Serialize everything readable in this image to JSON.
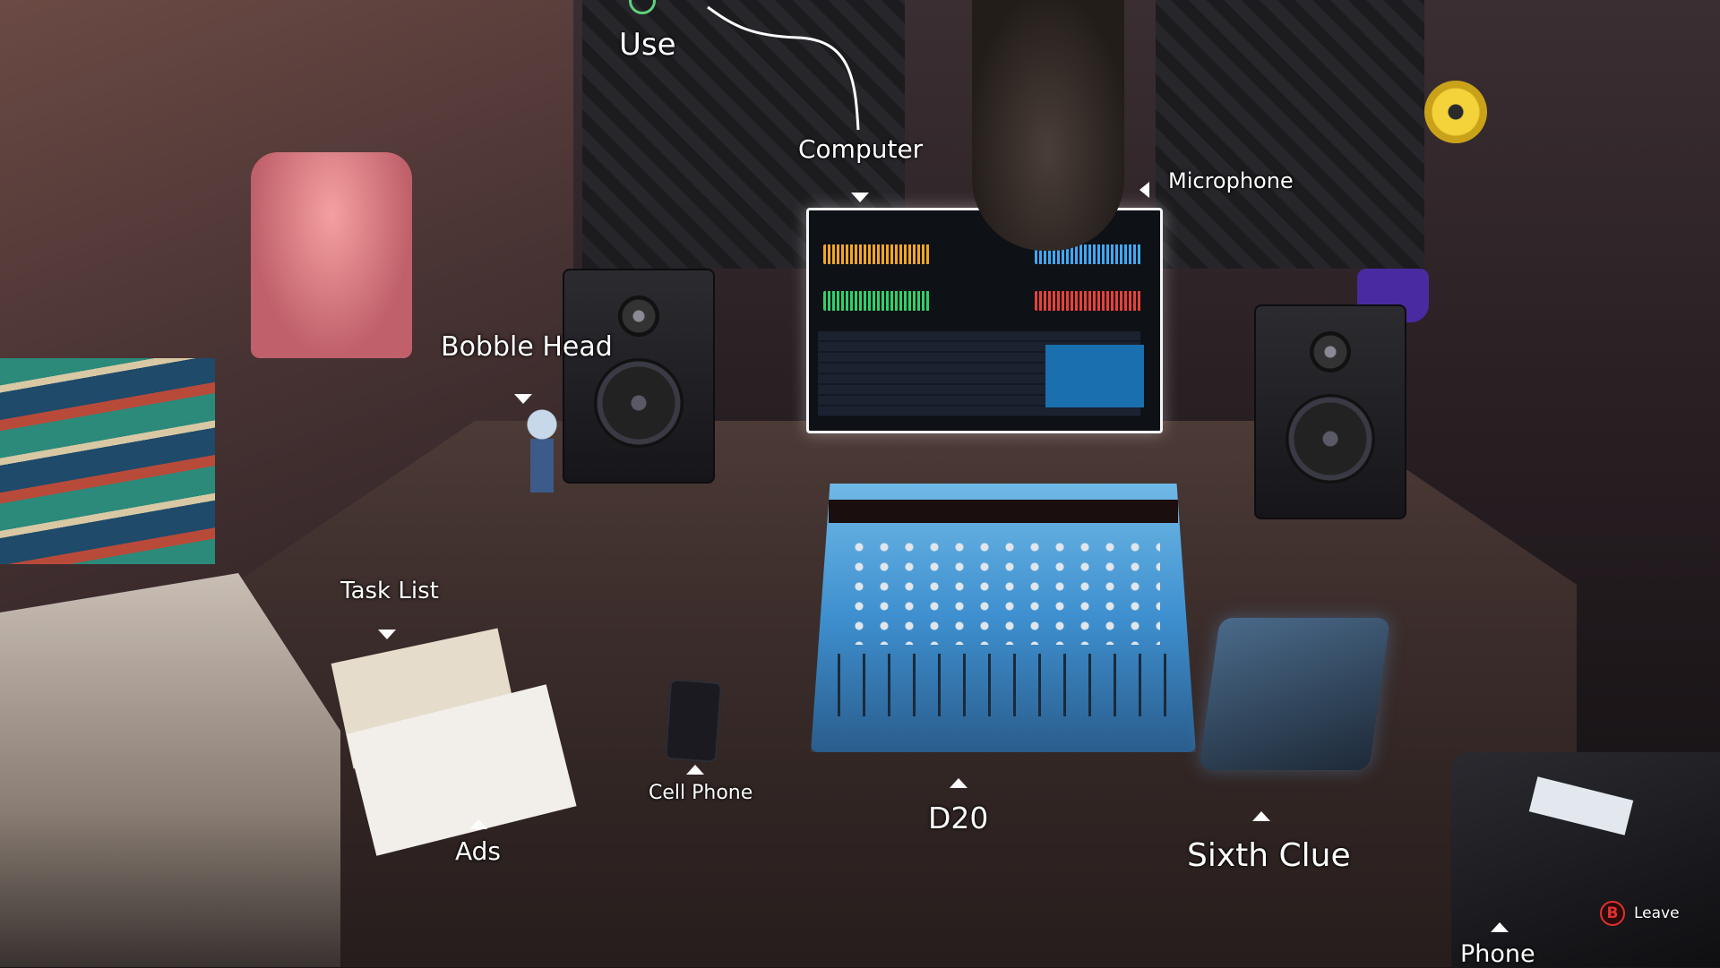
{
  "hud": {
    "use_label": "Use",
    "leave_button_glyph": "B",
    "leave_label": "Leave"
  },
  "hotspots": {
    "computer": "Computer",
    "microphone": "Microphone",
    "bobble_head": "Bobble Head",
    "task_list": "Task List",
    "cell_phone": "Cell Phone",
    "ads": "Ads",
    "d20": "D20",
    "sixth_clue": "Sixth Clue",
    "phone": "Phone"
  },
  "colors": {
    "use_icon": "#5fd07a",
    "leave_button": "#e0312e",
    "label_text": "#ffffff"
  }
}
